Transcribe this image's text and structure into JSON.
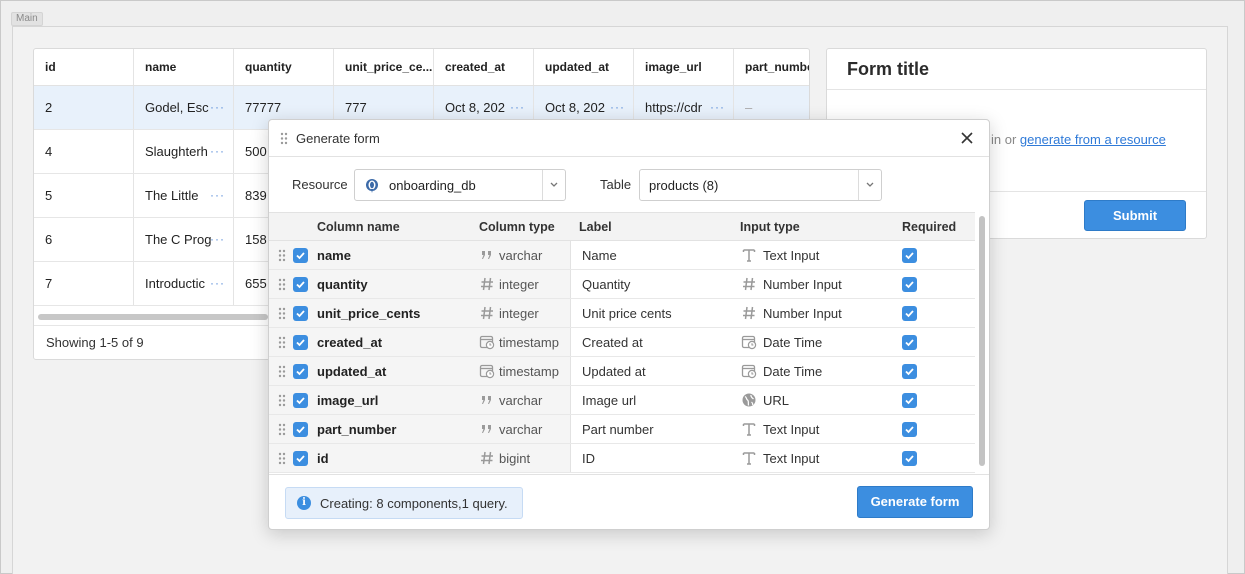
{
  "frame": {
    "tag": "Main"
  },
  "table": {
    "columns": [
      "id",
      "name",
      "quantity",
      "unit_price_ce...",
      "created_at",
      "updated_at",
      "image_url",
      "part_numbe"
    ],
    "rows": [
      {
        "id": "2",
        "name": "Godel, Esc",
        "quantity": "77777",
        "unit_price": "777",
        "created_at": "Oct 8, 202",
        "updated_at": "Oct 8, 202",
        "image_url": "https://cdr",
        "part_number": "–"
      },
      {
        "id": "4",
        "name": "Slaughterh",
        "quantity": "500"
      },
      {
        "id": "5",
        "name": "The Little ",
        "quantity": "839"
      },
      {
        "id": "6",
        "name": "The C Prog",
        "quantity": "158"
      },
      {
        "id": "7",
        "name": "Introductic",
        "quantity": "655"
      }
    ],
    "footer": "Showing 1-5 of 9"
  },
  "form": {
    "title": "Form title",
    "body_prefix": "in or ",
    "body_link": "generate from a resource",
    "submit": "Submit"
  },
  "modal": {
    "title": "Generate form",
    "resource_label": "Resource",
    "resource_value": "onboarding_db",
    "table_label": "Table",
    "table_value": "products (8)",
    "headers": {
      "column_name": "Column name",
      "column_type": "Column type",
      "label": "Label",
      "input_type": "Input type",
      "required": "Required"
    },
    "rows": [
      {
        "name": "name",
        "type": "varchar",
        "type_icon": "quote-icon",
        "label": "Name",
        "input": "Text Input",
        "input_icon": "text-type-icon"
      },
      {
        "name": "quantity",
        "type": "integer",
        "type_icon": "hash-icon",
        "label": "Quantity",
        "input": "Number Input",
        "input_icon": "hash-icon"
      },
      {
        "name": "unit_price_cents",
        "type": "integer",
        "type_icon": "hash-icon",
        "label": "Unit price cents",
        "input": "Number Input",
        "input_icon": "hash-icon"
      },
      {
        "name": "created_at",
        "type": "timestamp",
        "type_icon": "calendar-clock-icon",
        "label": "Created at",
        "input": "Date Time",
        "input_icon": "calendar-clock-icon"
      },
      {
        "name": "updated_at",
        "type": "timestamp",
        "type_icon": "calendar-clock-icon",
        "label": "Updated at",
        "input": "Date Time",
        "input_icon": "calendar-clock-icon"
      },
      {
        "name": "image_url",
        "type": "varchar",
        "type_icon": "quote-icon",
        "label": "Image url",
        "input": "URL",
        "input_icon": "globe-icon"
      },
      {
        "name": "part_number",
        "type": "varchar",
        "type_icon": "quote-icon",
        "label": "Part number",
        "input": "Text Input",
        "input_icon": "text-type-icon"
      },
      {
        "name": "id",
        "type": "bigint",
        "type_icon": "hash-icon",
        "label": "ID",
        "input": "Text Input",
        "input_icon": "text-type-icon"
      }
    ],
    "info": "Creating: 8 components,1 query.",
    "generate": "Generate form"
  },
  "colors": {
    "accent": "#3c8ee0",
    "selected_row": "#e8f1fb",
    "info_bg": "#e7f0fb"
  }
}
